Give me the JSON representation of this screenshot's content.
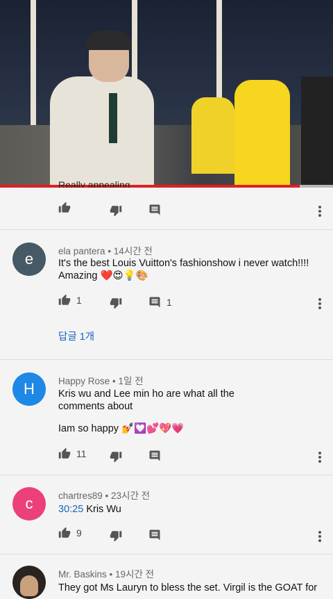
{
  "video": {
    "progress": 0.9
  },
  "top_comment_cutoff": "Really appealing",
  "comments": [
    {
      "author": "ela pantera",
      "time": "14시간 전",
      "avatar_letter": "e",
      "avatar_color": "#455a64",
      "text_lines": [
        "It's the best  Louis Vuitton's fashionshow i never watch!!!!",
        "Amazing ❤️😍💡🎨"
      ],
      "likes": "1",
      "replies_count": "1",
      "replies_label": "답글 1개"
    },
    {
      "author": "Happy Rose",
      "time": "1일 전",
      "avatar_letter": "H",
      "avatar_color": "#1e88e5",
      "text_lines": [
        "Kris wu  and Lee min ho are what all the",
        "comments about",
        "Iam so happy 💅💟💕💖💗"
      ],
      "likes": "11"
    },
    {
      "author": "chartres89",
      "time": "23시간 전",
      "avatar_letter": "c",
      "avatar_color": "#ec407a",
      "timestamp_link": "30:25",
      "text_after_link": " Kris Wu",
      "likes": "9"
    },
    {
      "author": "Mr. Baskins",
      "time": "19시간 전",
      "text_lines": [
        "They got Ms Lauryn to bless the set. Virgil is the GOAT for"
      ]
    }
  ],
  "icons": {
    "like": "thumb-up-icon",
    "dislike": "thumb-down-icon",
    "reply": "comment-icon",
    "more": "more-vert-icon"
  }
}
